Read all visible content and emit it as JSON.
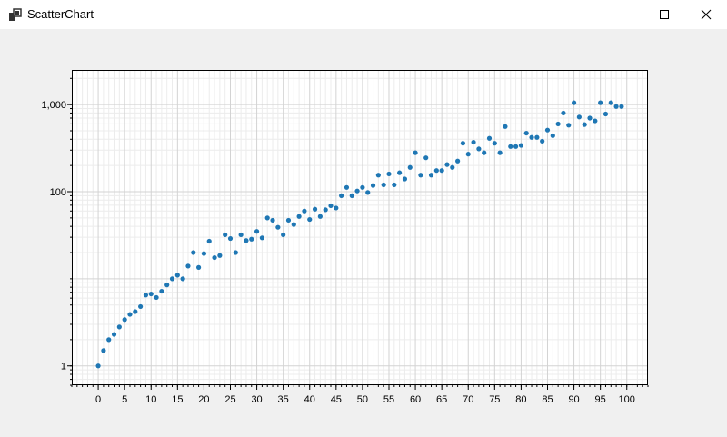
{
  "window": {
    "title": "ScatterChart"
  },
  "icons": {
    "app": "chart-app-icon",
    "minimize": "minimize-icon",
    "maximize": "maximize-icon",
    "close": "close-icon"
  },
  "colors": {
    "marker": "#1f77b4",
    "grid_major": "#d3d3d3",
    "grid_minor": "#ececec",
    "plot_background": "#ffffff",
    "axis": "#000000"
  },
  "chart_data": {
    "type": "scatter",
    "title": "",
    "xlabel": "",
    "ylabel": "",
    "xlim": [
      -5,
      104
    ],
    "ylim": [
      0.6,
      2500
    ],
    "y_scale": "log",
    "grid": true,
    "legend": "none",
    "x_ticks": [
      0,
      5,
      10,
      15,
      20,
      25,
      30,
      35,
      40,
      45,
      50,
      55,
      60,
      65,
      70,
      75,
      80,
      85,
      90,
      95,
      100
    ],
    "x_tick_labels": [
      "0",
      "5",
      "10",
      "15",
      "20",
      "25",
      "30",
      "35",
      "40",
      "45",
      "50",
      "55",
      "60",
      "65",
      "70",
      "75",
      "80",
      "85",
      "90",
      "95",
      "100"
    ],
    "y_ticks": [
      1,
      100,
      1000
    ],
    "y_tick_labels": [
      "1",
      "100",
      "1,000"
    ],
    "series": [
      {
        "marker": "circle",
        "points": [
          [
            0,
            1.0
          ],
          [
            1,
            1.5
          ],
          [
            2,
            2.0
          ],
          [
            3,
            2.3
          ],
          [
            4,
            2.8
          ],
          [
            5,
            3.4
          ],
          [
            6,
            3.9
          ],
          [
            7,
            4.2
          ],
          [
            8,
            4.8
          ],
          [
            9,
            6.5
          ],
          [
            10,
            6.7
          ],
          [
            11,
            6.1
          ],
          [
            12,
            7.2
          ],
          [
            13,
            8.5
          ],
          [
            14,
            10.0
          ],
          [
            15,
            11.0
          ],
          [
            16,
            10.0
          ],
          [
            17,
            14.0
          ],
          [
            18,
            20.0
          ],
          [
            19,
            13.5
          ],
          [
            20,
            19.5
          ],
          [
            21,
            27.0
          ],
          [
            22,
            17.5
          ],
          [
            23,
            18.5
          ],
          [
            24,
            32.0
          ],
          [
            25,
            29.0
          ],
          [
            26,
            20.0
          ],
          [
            27,
            32.0
          ],
          [
            28,
            27.5
          ],
          [
            29,
            28.5
          ],
          [
            30,
            35.0
          ],
          [
            31,
            29.5
          ],
          [
            32,
            50.0
          ],
          [
            33,
            47.0
          ],
          [
            34,
            39.0
          ],
          [
            35,
            32.0
          ],
          [
            36,
            47.0
          ],
          [
            37,
            42.0
          ],
          [
            38,
            52.0
          ],
          [
            39,
            60.0
          ],
          [
            40,
            48.0
          ],
          [
            41,
            63.0
          ],
          [
            42,
            52.0
          ],
          [
            43,
            62.0
          ],
          [
            44,
            69.0
          ],
          [
            45,
            65.0
          ],
          [
            46,
            90.0
          ],
          [
            47,
            112.0
          ],
          [
            48,
            90.0
          ],
          [
            49,
            102.0
          ],
          [
            50,
            112.0
          ],
          [
            51,
            98.0
          ],
          [
            52,
            118.0
          ],
          [
            53,
            155.0
          ],
          [
            54,
            120.0
          ],
          [
            55,
            160.0
          ],
          [
            56,
            120.0
          ],
          [
            57,
            165.0
          ],
          [
            58,
            140.0
          ],
          [
            59,
            190.0
          ],
          [
            60,
            280.0
          ],
          [
            61,
            155.0
          ],
          [
            62,
            245.0
          ],
          [
            63,
            155.0
          ],
          [
            64,
            175.0
          ],
          [
            65,
            175.0
          ],
          [
            66,
            205.0
          ],
          [
            67,
            190.0
          ],
          [
            68,
            225.0
          ],
          [
            69,
            360.0
          ],
          [
            70,
            270.0
          ],
          [
            71,
            370.0
          ],
          [
            72,
            310.0
          ],
          [
            73,
            280.0
          ],
          [
            74,
            410.0
          ],
          [
            75,
            360.0
          ],
          [
            76,
            280.0
          ],
          [
            77,
            560.0
          ],
          [
            78,
            330.0
          ],
          [
            79,
            330.0
          ],
          [
            80,
            340.0
          ],
          [
            81,
            470.0
          ],
          [
            82,
            420.0
          ],
          [
            83,
            420.0
          ],
          [
            84,
            380.0
          ],
          [
            85,
            510.0
          ],
          [
            86,
            440.0
          ],
          [
            87,
            600.0
          ],
          [
            88,
            800.0
          ],
          [
            89,
            580.0
          ],
          [
            90,
            1050.0
          ],
          [
            91,
            720.0
          ],
          [
            92,
            590.0
          ],
          [
            93,
            700.0
          ],
          [
            94,
            650.0
          ],
          [
            95,
            1050.0
          ],
          [
            96,
            780.0
          ],
          [
            97,
            1050.0
          ],
          [
            98,
            950.0
          ],
          [
            99,
            950.0
          ]
        ]
      }
    ]
  }
}
